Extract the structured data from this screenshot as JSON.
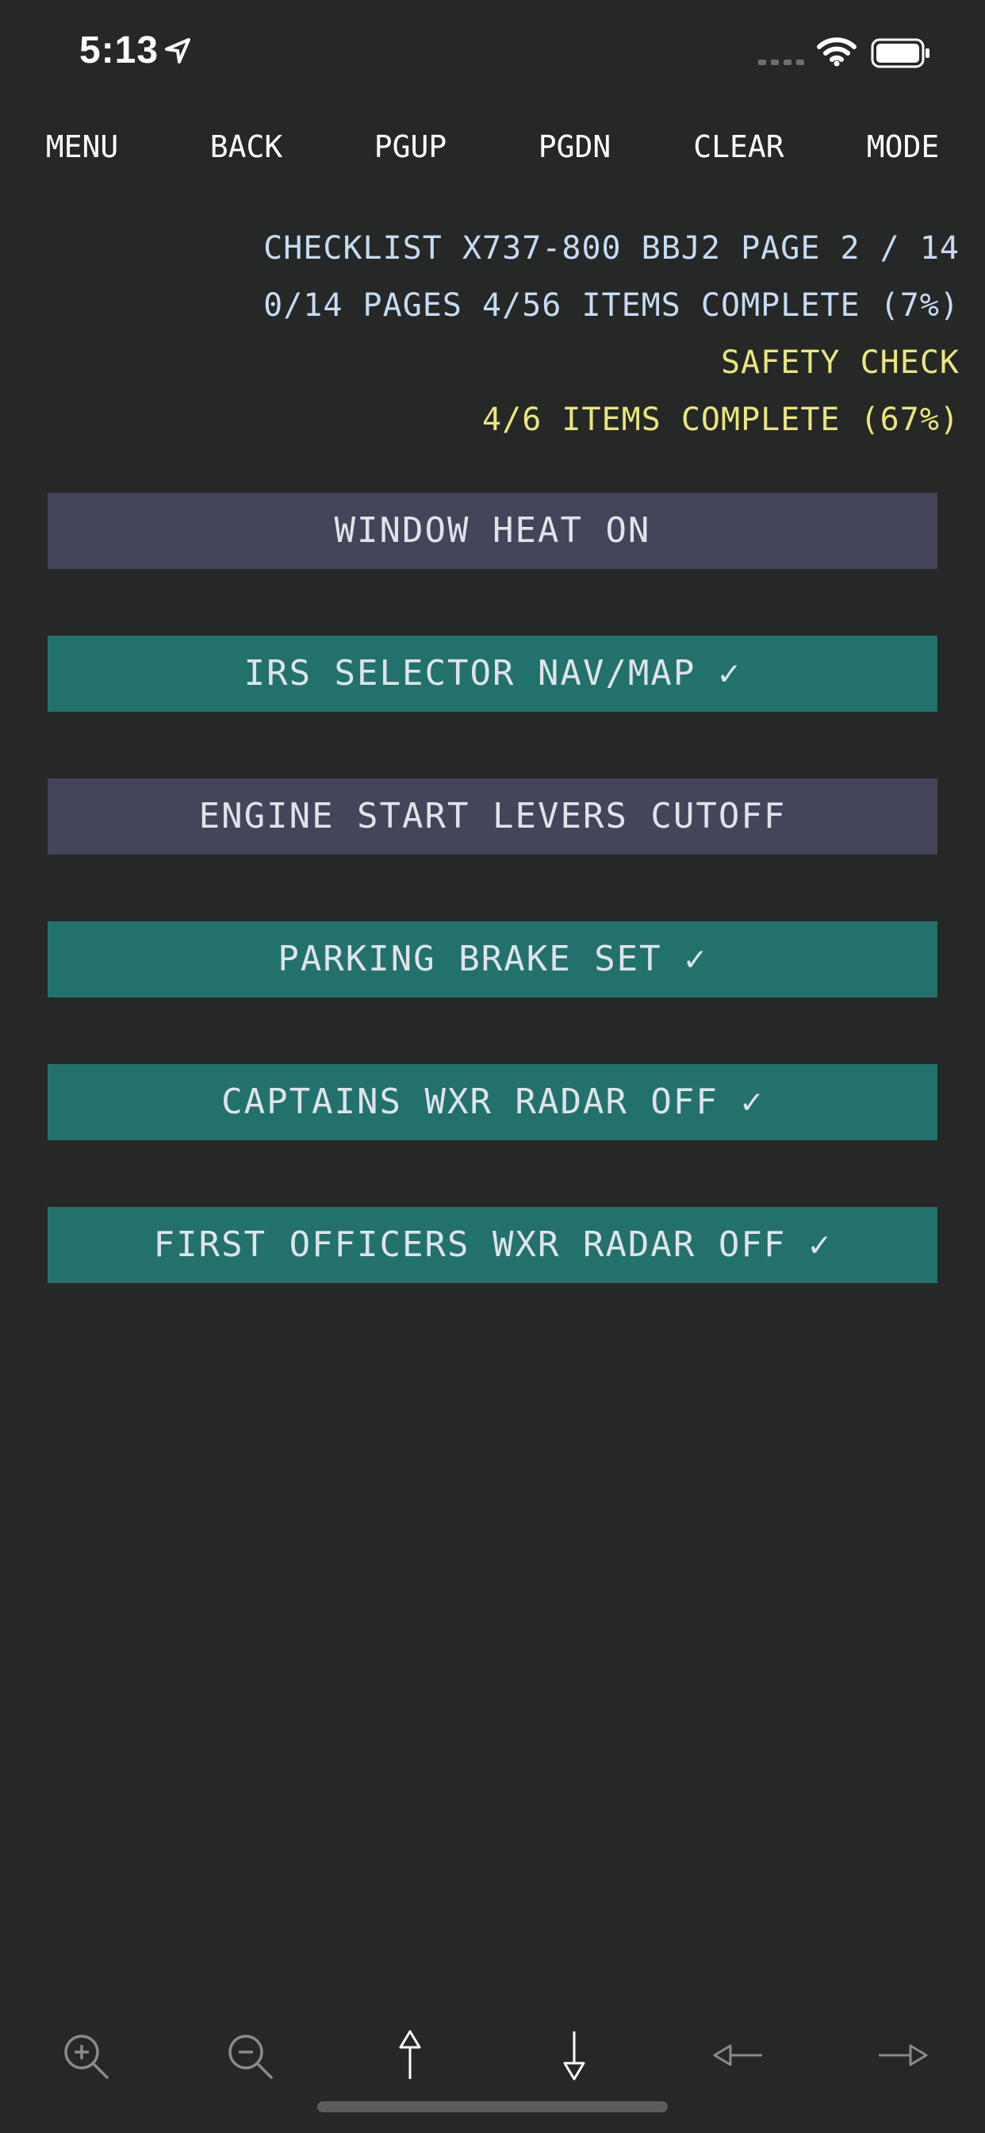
{
  "status_bar": {
    "time": "5:13"
  },
  "top_menu": {
    "menu": "MENU",
    "back": "BACK",
    "pgup": "PGUP",
    "pgdn": "PGDN",
    "clear": "CLEAR",
    "mode": "MODE"
  },
  "header": {
    "checklist_line": "CHECKLIST X737-800 BBJ2 PAGE 2 / 14",
    "progress_line": "0/14 PAGES 4/56 ITEMS COMPLETE (7%)",
    "section_title": "SAFETY CHECK",
    "section_progress": "4/6 ITEMS COMPLETE (67%)"
  },
  "items": [
    {
      "label": "WINDOW HEAT ON",
      "checked": false
    },
    {
      "label": "IRS SELECTOR NAV/MAP ✓",
      "checked": true
    },
    {
      "label": "ENGINE START LEVERS CUTOFF",
      "checked": false
    },
    {
      "label": "PARKING BRAKE SET ✓",
      "checked": true
    },
    {
      "label": "CAPTAINS WXR RADAR OFF ✓",
      "checked": true
    },
    {
      "label": "FIRST OFFICERS WXR RADAR OFF ✓",
      "checked": true
    }
  ],
  "toolbar": {
    "icons": [
      "zoom-in-icon",
      "zoom-out-icon",
      "arrow-up-icon",
      "arrow-down-icon",
      "arrow-left-icon",
      "arrow-right-icon"
    ]
  },
  "colors": {
    "background": "#262727",
    "info_text": "#c6dcf3",
    "section_text": "#eae77c",
    "item_pending": "#44455a",
    "item_done": "#23716d"
  }
}
